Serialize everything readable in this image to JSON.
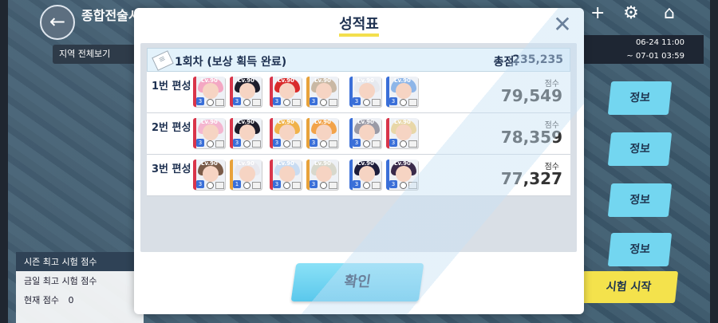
{
  "top_bar": {
    "back_label": "←",
    "title": "종합전술시험",
    "plus_icon": "+",
    "gear_icon": "⚙",
    "home_icon": "⌂"
  },
  "region_chip": "지역 전체보기",
  "date_range": {
    "start": "06-24 11:00",
    "end": "~ 07-01 03:59"
  },
  "info_buttons": [
    "정보",
    "정보",
    "정보",
    "정보"
  ],
  "start_button": "시험 시작",
  "side_card": {
    "header": "시즌 최고 시험 점수",
    "today_best_label": "금일 최고 시험 점수",
    "current_label": "현재 점수",
    "current_value": "0"
  },
  "modal": {
    "title": "성적표",
    "close_icon": "✕",
    "run_label": "1회차 (보상 획득 완료)",
    "total_label": "총점:",
    "total_value": "235,235",
    "confirm_label": "확인",
    "teams": [
      {
        "label": "1번 편성",
        "score_caption": "점수",
        "score": "79,549",
        "units": [
          {
            "lv": "Lv.90",
            "edge": "#d9354a",
            "hair": "#f4a7c3",
            "badge": "3"
          },
          {
            "lv": "Lv.90",
            "edge": "#d9354a",
            "hair": "#1d1d2b",
            "badge": "3"
          },
          {
            "lv": "Lv.90",
            "edge": "#d9354a",
            "hair": "#d92b2b",
            "badge": "3"
          },
          {
            "lv": "Lv.90",
            "edge": "#e8a23a",
            "hair": "#c9b8a4",
            "badge": "3"
          },
          {
            "lv": "Lv.90",
            "edge": "#3a6fd8",
            "hair": "#e6e9ef",
            "badge": "3"
          },
          {
            "lv": "Lv.90",
            "edge": "#3a6fd8",
            "hair": "#8eb6e8",
            "badge": "3"
          }
        ]
      },
      {
        "label": "2번 편성",
        "score_caption": "점수",
        "score": "78,359",
        "units": [
          {
            "lv": "Lv.90",
            "edge": "#d9354a",
            "hair": "#f4b6d0",
            "badge": "3"
          },
          {
            "lv": "Lv.90",
            "edge": "#d9354a",
            "hair": "#1d1d2b",
            "badge": "3"
          },
          {
            "lv": "Lv.90",
            "edge": "#d9354a",
            "hair": "#f0b24a",
            "badge": "3"
          },
          {
            "lv": "Lv.90",
            "edge": "#e8a23a",
            "hair": "#f2a34a",
            "badge": "3"
          },
          {
            "lv": "Lv.90",
            "edge": "#3a6fd8",
            "hair": "#9a9aa6",
            "badge": "3"
          },
          {
            "lv": "Lv.90",
            "edge": "#d9354a",
            "hair": "#e8d7a8",
            "badge": "3"
          }
        ]
      },
      {
        "label": "3번 편성",
        "score_caption": "점수",
        "score": "77,327",
        "units": [
          {
            "lv": "Lv.90",
            "edge": "#d9354a",
            "hair": "#7a5b48",
            "badge": "3"
          },
          {
            "lv": "Lv.90",
            "edge": "#e8a23a",
            "hair": "#e8e8ee",
            "badge": "1"
          },
          {
            "lv": "Lv.90",
            "edge": "#d9354a",
            "hair": "#c9dcf2",
            "badge": "3"
          },
          {
            "lv": "Lv.90",
            "edge": "#e8a23a",
            "hair": "#d8d8cc",
            "badge": "3"
          },
          {
            "lv": "Lv.90",
            "edge": "#3a6fd8",
            "hair": "#1d1d3b",
            "badge": "3"
          },
          {
            "lv": "Lv.90",
            "edge": "#3a6fd8",
            "hair": "#3a2a4a",
            "badge": "3"
          }
        ]
      }
    ]
  }
}
